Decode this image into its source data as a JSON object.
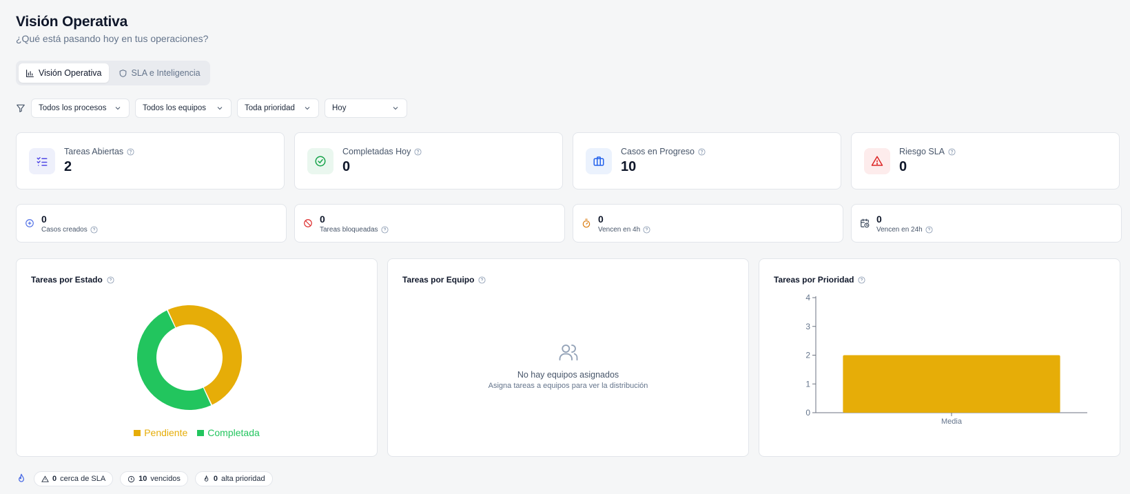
{
  "header": {
    "title": "Visión Operativa",
    "subtitle": "¿Qué está pasando hoy en tus operaciones?"
  },
  "tabs": [
    {
      "label": "Visión Operativa",
      "active": true,
      "icon": "bar-chart-icon"
    },
    {
      "label": "SLA e Inteligencia",
      "active": false,
      "icon": "shield-icon"
    }
  ],
  "filters": [
    {
      "value": "Todos los procesos"
    },
    {
      "value": "Todos los equipos"
    },
    {
      "value": "Toda prioridad"
    },
    {
      "value": "Hoy"
    }
  ],
  "kpis": [
    {
      "label": "Tareas Abiertas",
      "value": "2",
      "icon": "list-check-icon",
      "color": "#4f46e5",
      "bg": "#eef0fb"
    },
    {
      "label": "Completadas Hoy",
      "value": "0",
      "icon": "check-circle-icon",
      "color": "#16a34a",
      "bg": "#eaf7ef"
    },
    {
      "label": "Casos en Progreso",
      "value": "10",
      "icon": "briefcase-icon",
      "color": "#2563eb",
      "bg": "#ebf2fd"
    },
    {
      "label": "Riesgo SLA",
      "value": "0",
      "icon": "alert-triangle-icon",
      "color": "#dc2626",
      "bg": "#fdecec"
    }
  ],
  "minis": [
    {
      "label": "Casos creados",
      "value": "0",
      "icon": "plus-circle-icon",
      "color": "#4f6fe5"
    },
    {
      "label": "Tareas bloqueadas",
      "value": "0",
      "icon": "ban-icon",
      "color": "#dc2626"
    },
    {
      "label": "Vencen en 4h",
      "value": "0",
      "icon": "timer-icon",
      "color": "#d97706"
    },
    {
      "label": "Vencen en 24h",
      "value": "0",
      "icon": "calendar-clock-icon",
      "color": "#334155"
    }
  ],
  "charts": {
    "estado": {
      "title": "Tareas por Estado"
    },
    "equipo": {
      "title": "Tareas por Equipo",
      "empty_title": "No hay equipos asignados",
      "empty_sub": "Asigna tareas a equipos para ver la distribución"
    },
    "prioridad": {
      "title": "Tareas por Prioridad"
    }
  },
  "chart_data": [
    {
      "type": "pie",
      "title": "Tareas por Estado",
      "categories": [
        "Pendiente",
        "Completada"
      ],
      "values": [
        1,
        1
      ],
      "colors": [
        "#e6ad08",
        "#22c55e"
      ],
      "legend": "bottom"
    },
    {
      "type": "bar",
      "title": "Tareas por Prioridad",
      "categories": [
        "Media"
      ],
      "values": [
        2
      ],
      "ylim": [
        0,
        4
      ],
      "yticks": [
        0,
        1,
        2,
        3,
        4
      ],
      "colors": [
        "#e6ad08"
      ],
      "grid": false
    }
  ],
  "footer": [
    {
      "value": "0",
      "label": "cerca de SLA",
      "icon": "alert-triangle-icon"
    },
    {
      "value": "10",
      "label": "vencidos",
      "icon": "clock-icon"
    },
    {
      "value": "0",
      "label": "alta prioridad",
      "icon": "flame-icon"
    }
  ]
}
